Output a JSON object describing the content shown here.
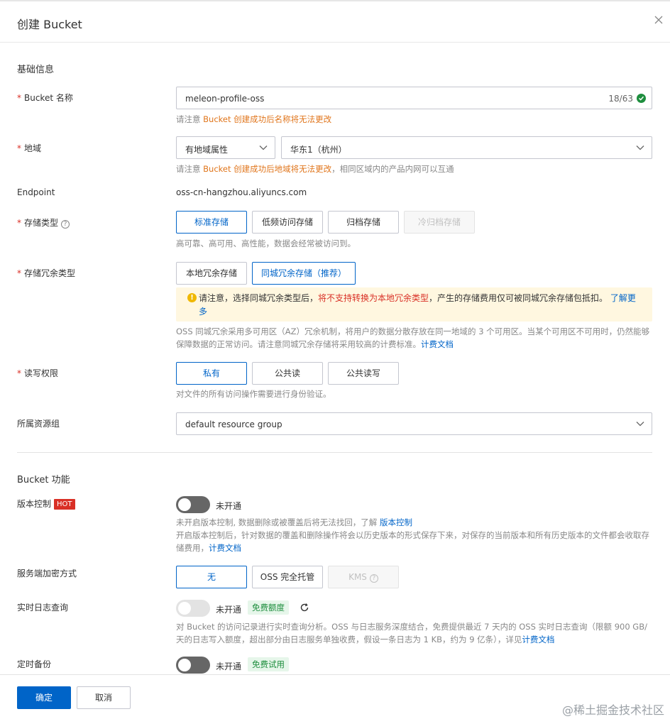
{
  "dialog": {
    "title": "创建 Bucket"
  },
  "basic": {
    "section_title": "基础信息",
    "bucket_name": {
      "label": "Bucket 名称",
      "value": "meleon-profile-oss",
      "count": "18/63",
      "hint_prefix": "请注意",
      "hint_warn": "Bucket 创建成功后名称将无法更改"
    },
    "region": {
      "label": "地域",
      "attr_select": "有地域属性",
      "region_select": "华东1（杭州）",
      "hint_prefix": "请注意",
      "hint_warn": "Bucket 创建成功后地域将无法更改",
      "hint_suffix": "，相同区域内的产品内网可以互通"
    },
    "endpoint": {
      "label": "Endpoint",
      "value": "oss-cn-hangzhou.aliyuncs.com"
    },
    "storage_class": {
      "label": "存储类型",
      "options": [
        "标准存储",
        "低频访问存储",
        "归档存储",
        "冷归档存储"
      ],
      "hint": "高可靠、高可用、高性能，数据会经常被访问到。"
    },
    "redundancy": {
      "label": "存储冗余类型",
      "options": [
        "本地冗余存储",
        "同城冗余存储（推荐）"
      ],
      "notice_prefix": "请注意，选择同城冗余类型后，",
      "notice_red": "将不支持转换为本地冗余类型",
      "notice_suffix": "，产生的存储费用仅可被同城冗余存储包抵扣。",
      "notice_link": "了解更多",
      "hint": "OSS 同城冗余采用多可用区（AZ）冗余机制，将用户的数据分散存放在同一地域的 3 个可用区。当某个可用区不可用时，仍然能够保障数据的正常访问。请注意同城冗余存储将采用较高的计费标准。",
      "hint_link": "计费文档"
    },
    "acl": {
      "label": "读写权限",
      "options": [
        "私有",
        "公共读",
        "公共读写"
      ],
      "hint": "对文件的所有访问操作需要进行身份验证。"
    },
    "resource_group": {
      "label": "所属资源组",
      "value": "default resource group"
    }
  },
  "features": {
    "section_title": "Bucket 功能",
    "versioning": {
      "label": "版本控制",
      "badge": "HOT",
      "state": "未开通",
      "hint1": "未开启版本控制, 数据删除或被覆盖后将无法找回，了解",
      "hint1_link": "版本控制",
      "hint2": "开启版本控制后，针对数据的覆盖和删除操作将会以历史版本的形式保存下来，对保存的当前版本和所有历史版本的文件都会收取存储费用，",
      "hint2_link": "计费文档"
    },
    "encryption": {
      "label": "服务端加密方式",
      "options": [
        "无",
        "OSS 完全托管",
        "KMS"
      ]
    },
    "realtime_log": {
      "label": "实时日志查询",
      "state": "未开通",
      "tag": "免费额度",
      "hint": "对 Bucket 的访问记录进行实时查询分析。OSS 与日志服务深度结合，免费提供最近 7 天内的 OSS 实时日志查询（限额 900 GB/天的日志写入额度，超出部分由日志服务单独收费，假设一条日志为 1 KB，约为 9 亿条），详见",
      "hint_link": "计费文档"
    },
    "backup": {
      "label": "定时备份",
      "state": "未开通",
      "tag": "免费试用"
    }
  },
  "footer": {
    "confirm": "确定",
    "cancel": "取消",
    "watermark": "@稀土掘金技术社区"
  },
  "colors": {
    "primary": "#0064c8",
    "warn": "#e0751b",
    "danger": "#d93026",
    "success": "#1e8e3e"
  }
}
